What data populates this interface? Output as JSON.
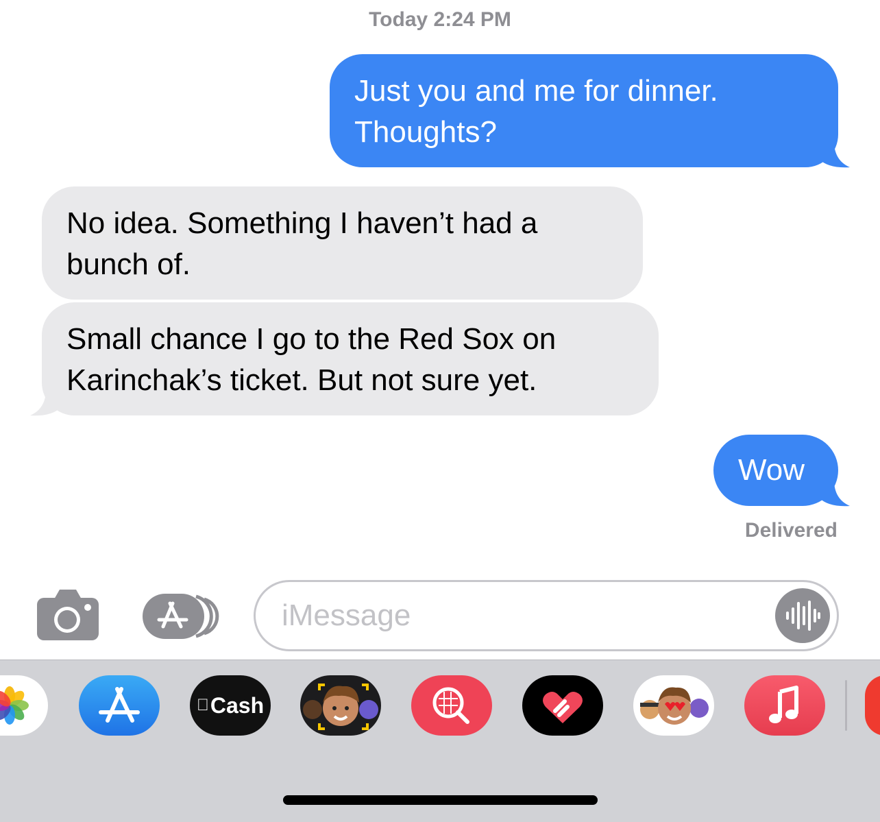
{
  "thread": {
    "timestamp": "Today 2:24 PM",
    "messages": [
      {
        "direction": "sent",
        "lines": [
          "Just you and me for dinner.",
          "Thoughts?"
        ]
      },
      {
        "direction": "received",
        "lines": [
          "No idea. Something I haven’t had a",
          "bunch of."
        ]
      },
      {
        "direction": "received",
        "lines": [
          "Small chance I go to the Red Sox on",
          "Karinchak’s ticket. But not sure yet."
        ]
      },
      {
        "direction": "sent",
        "lines": [
          "Wow"
        ]
      }
    ],
    "status": "Delivered"
  },
  "composer": {
    "camera_icon": "camera-icon",
    "apps_icon": "app-store-icon",
    "placeholder": "iMessage",
    "voice_icon": "waveform-icon"
  },
  "app_drawer": {
    "apps": [
      {
        "name": "photos-icon"
      },
      {
        "name": "app-store-icon"
      },
      {
        "name": "apple-cash-icon",
        "label": "Cash"
      },
      {
        "name": "memoji-stickers-icon"
      },
      {
        "name": "images-search-icon"
      },
      {
        "name": "digital-touch-icon"
      },
      {
        "name": "animoji-icon"
      },
      {
        "name": "music-icon"
      }
    ]
  },
  "colors": {
    "sent_bubble": "#3b86f4",
    "received_bubble": "#e9e9eb",
    "drawer_bg": "#d1d2d6"
  }
}
